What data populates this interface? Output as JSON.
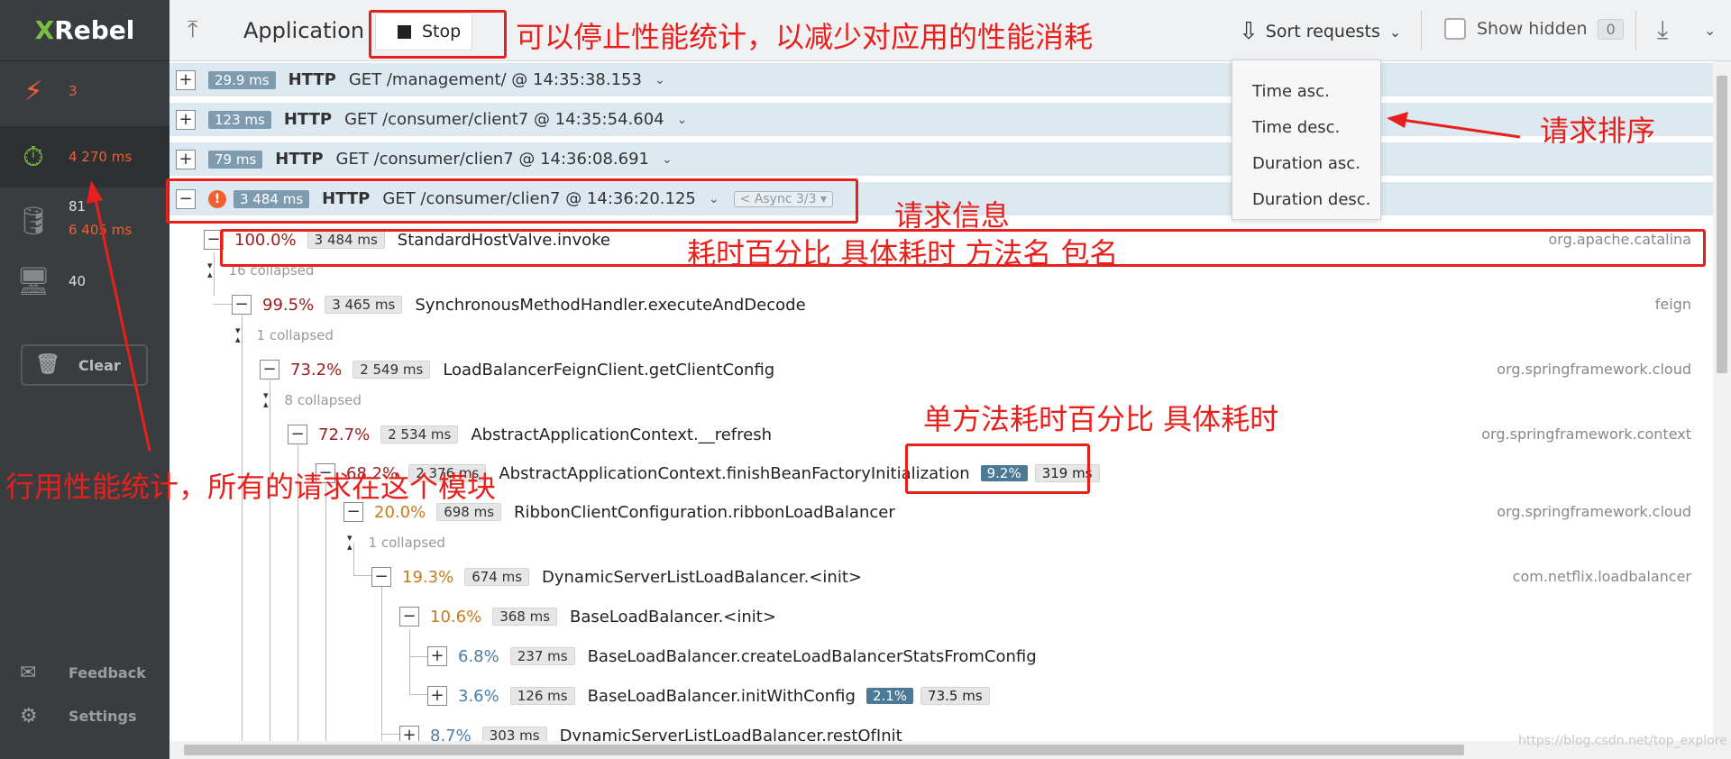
{
  "sidebar": {
    "logo": {
      "x": "X",
      "rest": "Rebel"
    },
    "items": [
      {
        "icon": "lightning-icon",
        "value": "3"
      },
      {
        "icon": "stopwatch-icon",
        "value": "4 270 ms"
      },
      {
        "icon": "database-icon",
        "value": "81",
        "value2": "6 405 ms"
      },
      {
        "icon": "monitor-icon",
        "value": "40"
      }
    ],
    "clear_label": "Clear",
    "feedback_label": "Feedback",
    "settings_label": "Settings"
  },
  "topbar": {
    "title": "Application",
    "stop_label": "Stop",
    "sort_label": "Sort requests",
    "show_hidden_label": "Show hidden",
    "hidden_count": "0"
  },
  "sort_menu": [
    "Time asc.",
    "Time desc.",
    "Duration asc.",
    "Duration desc."
  ],
  "requests": [
    {
      "duration": "29.9 ms",
      "method": "HTTP",
      "text": "GET /management/  @ 14:35:38.153"
    },
    {
      "duration": "123 ms",
      "method": "HTTP",
      "text": "GET /consumer/client7  @ 14:35:54.604"
    },
    {
      "duration": "79 ms",
      "method": "HTTP",
      "text": "GET /consumer/clien7  @ 14:36:08.691"
    },
    {
      "duration": "3 484 ms",
      "method": "HTTP",
      "text": "GET /consumer/clien7  @ 14:36:20.125",
      "async": "Async 3/3"
    }
  ],
  "tree": [
    {
      "pct": "100.0%",
      "ms": "3 484 ms",
      "name": "StandardHostValve.invoke",
      "pkg": "org.apache.catalina"
    },
    {
      "collapsed": "16 collapsed"
    },
    {
      "pct": "99.5%",
      "ms": "3 465 ms",
      "name": "SynchronousMethodHandler.executeAndDecode",
      "pkg": "feign"
    },
    {
      "collapsed": "1 collapsed"
    },
    {
      "pct": "73.2%",
      "ms": "2 549 ms",
      "name": "LoadBalancerFeignClient.getClientConfig",
      "pkg": "org.springframework.cloud"
    },
    {
      "collapsed": "8 collapsed"
    },
    {
      "pct": "72.7%",
      "ms": "2 534 ms",
      "name": "AbstractApplicationContext.__refresh",
      "pkg": "org.springframework.context"
    },
    {
      "pct": "68.2%",
      "ms": "2 376 ms",
      "name": "AbstractApplicationContext.finishBeanFactoryInitialization",
      "self_pct": "9.2%",
      "self_ms": "319 ms"
    },
    {
      "pct": "20.0%",
      "ms": "698 ms",
      "name": "RibbonClientConfiguration.ribbonLoadBalancer",
      "pkg": "org.springframework.cloud"
    },
    {
      "collapsed": "1 collapsed"
    },
    {
      "pct": "19.3%",
      "ms": "674 ms",
      "name": "DynamicServerListLoadBalancer.<init>",
      "pkg": "com.netflix.loadbalancer"
    },
    {
      "pct": "10.6%",
      "ms": "368 ms",
      "name": "BaseLoadBalancer.<init>"
    },
    {
      "pct": "6.8%",
      "ms": "237 ms",
      "name": "BaseLoadBalancer.createLoadBalancerStatsFromConfig"
    },
    {
      "pct": "3.6%",
      "ms": "126 ms",
      "name": "BaseLoadBalancer.initWithConfig",
      "self_pct": "2.1%",
      "self_ms": "73.5 ms"
    },
    {
      "pct": "8.7%",
      "ms": "303 ms",
      "name": "DynamicServerListLoadBalancer.restOfInit"
    }
  ],
  "annotations": {
    "stop_note": "可以停止性能统计，以减少对应用的性能消耗",
    "sort_note": "请求排序",
    "request_info": "请求信息",
    "columns_note": "耗时百分比  具体耗时   方法名   包名",
    "single_method_note": "单方法耗时百分比 具体耗时",
    "sidebar_note": "行用性能统计，所有的请求在这个模块"
  },
  "watermark": "https://blog.csdn.net/top_explore",
  "colors": {
    "accent_red": "#e8201c",
    "sidebar_bg": "#3a3d40",
    "request_bg": "#dde9f1",
    "warning": "#f06030"
  }
}
